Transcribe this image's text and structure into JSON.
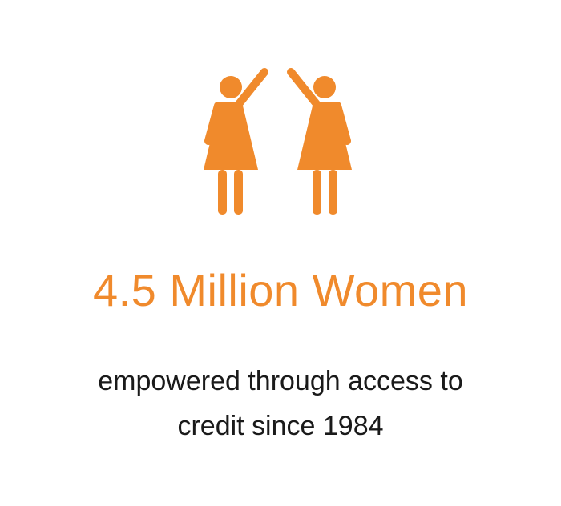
{
  "icon": {
    "name": "women-raising-hands-icon",
    "color": "#f08a2c"
  },
  "headline": "4.5 Million Women",
  "subtext": {
    "line1": "empowered through access to",
    "line2": "credit since 1984"
  },
  "colors": {
    "accent": "#f08a2c",
    "text": "#1a1a1a",
    "background": "#ffffff"
  }
}
